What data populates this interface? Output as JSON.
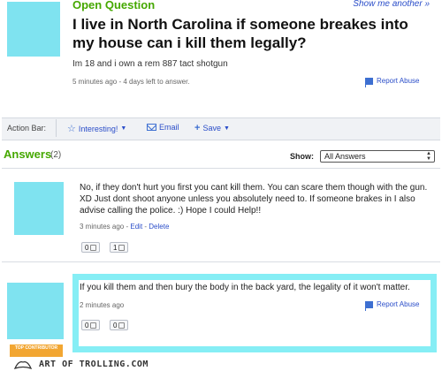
{
  "question": {
    "status_label": "Open Question",
    "show_more": "Show me another »",
    "title": "I live in North Carolina if someone breakes into my house can i kill them legally?",
    "detail": "Im 18 and i own a rem 887 tact shotgun",
    "meta": "5 minutes ago - 4 days left to answer.",
    "report_abuse": "Report Abuse"
  },
  "action_bar": {
    "label": "Action Bar:",
    "interesting": "Interesting!",
    "email": "Email",
    "save": "Save"
  },
  "answers_header": {
    "title": "Answers",
    "count": "(2)",
    "show_label": "Show:",
    "selected": "All Answers"
  },
  "answers": [
    {
      "text": "No, if they don't hurt you first you cant kill them. You can scare them though with the gun. XD Just dont shoot anyone unless you absolutely need to. If someone brakes in I also advise calling the police. :) Hope I could Help!!",
      "time": "3 minutes ago",
      "sep1": " - ",
      "edit": "Edit",
      "sep2": " - ",
      "delete": "Delete",
      "thumbs_up": "0",
      "thumbs_down": "1"
    },
    {
      "text": "If you kill them and then bury the body in the back yard, the legality of it won't matter.",
      "time": "2 minutes ago",
      "report_abuse": "Report Abuse",
      "thumbs_up": "0",
      "thumbs_down": "0",
      "badge": "TOP CONTRIBUTOR"
    }
  ],
  "footer": {
    "watermark": "ART OF TROLLING.COM"
  },
  "colors": {
    "accent_green": "#45a800",
    "link_blue": "#2b4ec9",
    "avatar_cyan": "#7fe3f0",
    "highlight_cyan": "#86eef5",
    "badge_orange": "#f2a632"
  }
}
